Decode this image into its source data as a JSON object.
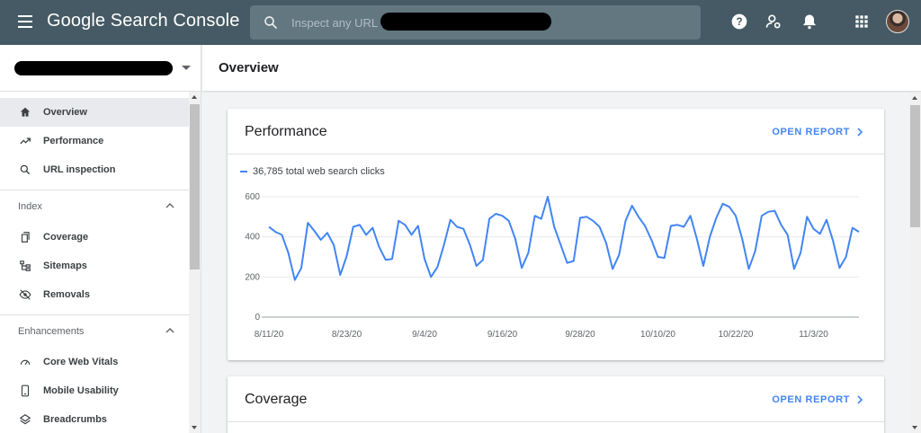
{
  "app": {
    "title": "Google Search Console"
  },
  "search": {
    "placeholder": "Inspect any URL in"
  },
  "sidebar": {
    "top_items": [
      {
        "label": "Overview",
        "icon": "home-icon"
      },
      {
        "label": "Performance",
        "icon": "trending-up-icon"
      },
      {
        "label": "URL inspection",
        "icon": "search-icon"
      }
    ],
    "index": {
      "title": "Index",
      "items": [
        {
          "label": "Coverage",
          "icon": "copy-icon"
        },
        {
          "label": "Sitemaps",
          "icon": "sitemap-icon"
        },
        {
          "label": "Removals",
          "icon": "visibility-off-icon"
        }
      ]
    },
    "enhancements": {
      "title": "Enhancements",
      "items": [
        {
          "label": "Core Web Vitals",
          "icon": "speed-icon"
        },
        {
          "label": "Mobile Usability",
          "icon": "smartphone-icon"
        },
        {
          "label": "Breadcrumbs",
          "icon": "layers-icon"
        }
      ]
    }
  },
  "header": {
    "title": "Overview"
  },
  "performance": {
    "title": "Performance",
    "open_report": "OPEN REPORT",
    "legend": "36,785 total web search clicks"
  },
  "coverage": {
    "title": "Coverage",
    "open_report": "OPEN REPORT"
  },
  "colors": {
    "topbar": "#455a64",
    "accent": "#4285f4"
  },
  "chart_data": {
    "type": "line",
    "title": "",
    "xlabel": "",
    "ylabel": "",
    "ylim": [
      0,
      600
    ],
    "yticks": [
      0,
      200,
      400,
      600
    ],
    "xtick_labels": [
      "8/11/20",
      "8/23/20",
      "9/4/20",
      "9/16/20",
      "9/28/20",
      "10/10/20",
      "10/22/20",
      "11/3/20"
    ],
    "start_date": "8/11/20",
    "series": [
      {
        "name": "36,785 total web search clicks",
        "color": "#4285f4",
        "values": [
          450,
          425,
          410,
          320,
          185,
          245,
          470,
          430,
          385,
          420,
          360,
          210,
          305,
          450,
          460,
          410,
          445,
          350,
          285,
          290,
          480,
          460,
          410,
          455,
          290,
          200,
          250,
          360,
          485,
          450,
          440,
          360,
          255,
          285,
          490,
          515,
          505,
          480,
          390,
          245,
          320,
          505,
          490,
          600,
          450,
          360,
          270,
          280,
          495,
          500,
          480,
          450,
          370,
          240,
          310,
          480,
          555,
          500,
          455,
          385,
          300,
          295,
          455,
          460,
          450,
          505,
          390,
          255,
          400,
          495,
          565,
          550,
          505,
          390,
          240,
          330,
          505,
          525,
          530,
          460,
          410,
          240,
          320,
          500,
          440,
          415,
          485,
          380,
          245,
          300,
          445,
          425
        ]
      }
    ]
  }
}
